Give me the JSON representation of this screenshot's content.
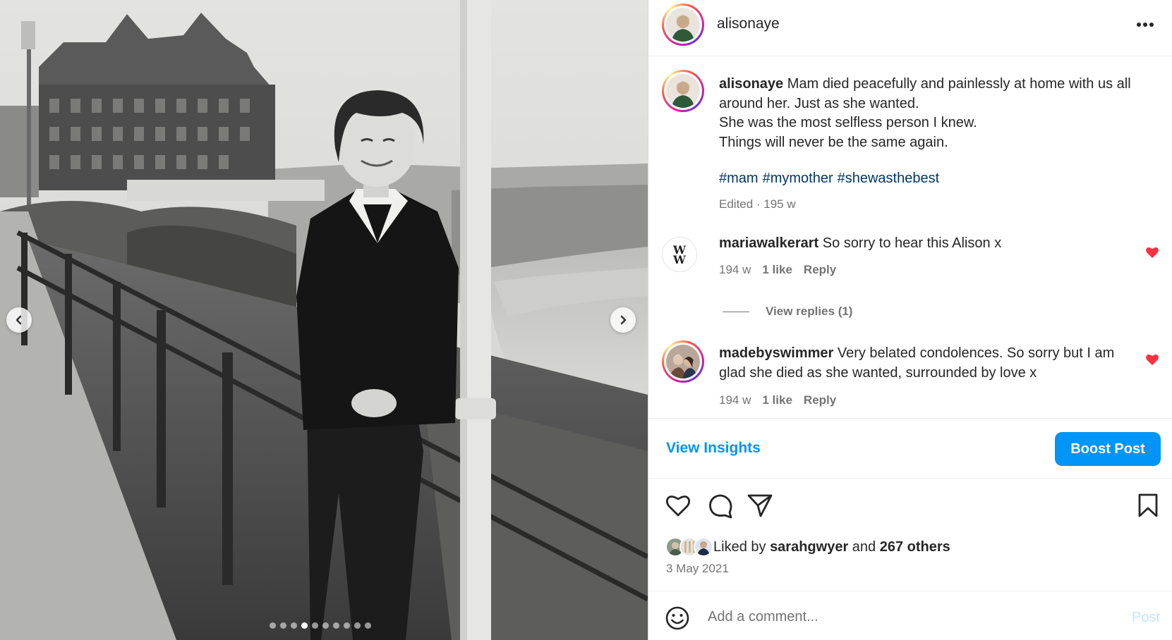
{
  "post": {
    "author": "alisonaye",
    "more_icon": "more-horizontal-icon"
  },
  "carousel": {
    "slide_count": 10,
    "active_index": 3,
    "prev_icon": "chevron-left-icon",
    "next_icon": "chevron-right-icon"
  },
  "caption": {
    "username": "alisonaye",
    "lines": [
      "Mam died peacefully and painlessly at home with us all around her. Just as she wanted.",
      "She was the most selfless person I knew.",
      "Things will never be the same again."
    ],
    "hashtags": [
      "#mam",
      "#mymother",
      "#shewasthebest"
    ],
    "meta": "Edited · 195 w"
  },
  "comments": [
    {
      "username": "mariawalkerart",
      "text": "So sorry to hear this Alison x",
      "age": "194 w",
      "likes": "1 like",
      "reply": "Reply",
      "liked": true
    },
    {
      "username": "madebyswimmer",
      "text": "Very belated condolences. So sorry but I am glad she died as she wanted, surrounded by love x",
      "age": "194 w",
      "likes": "1 like",
      "reply": "Reply",
      "liked": true
    }
  ],
  "view_replies": "View replies (1)",
  "insights": {
    "view_insights": "View Insights",
    "boost_post": "Boost Post"
  },
  "likes": {
    "prefix": "Liked by",
    "user": "sarahgwyer",
    "and": "and",
    "others": "267 others"
  },
  "date": "3 May 2021",
  "comment_input": {
    "placeholder": "Add a comment...",
    "post_label": "Post"
  },
  "colors": {
    "accent": "#0095f6",
    "heart_red": "#ff3040",
    "hashtag": "#00376b",
    "muted": "#737373"
  }
}
